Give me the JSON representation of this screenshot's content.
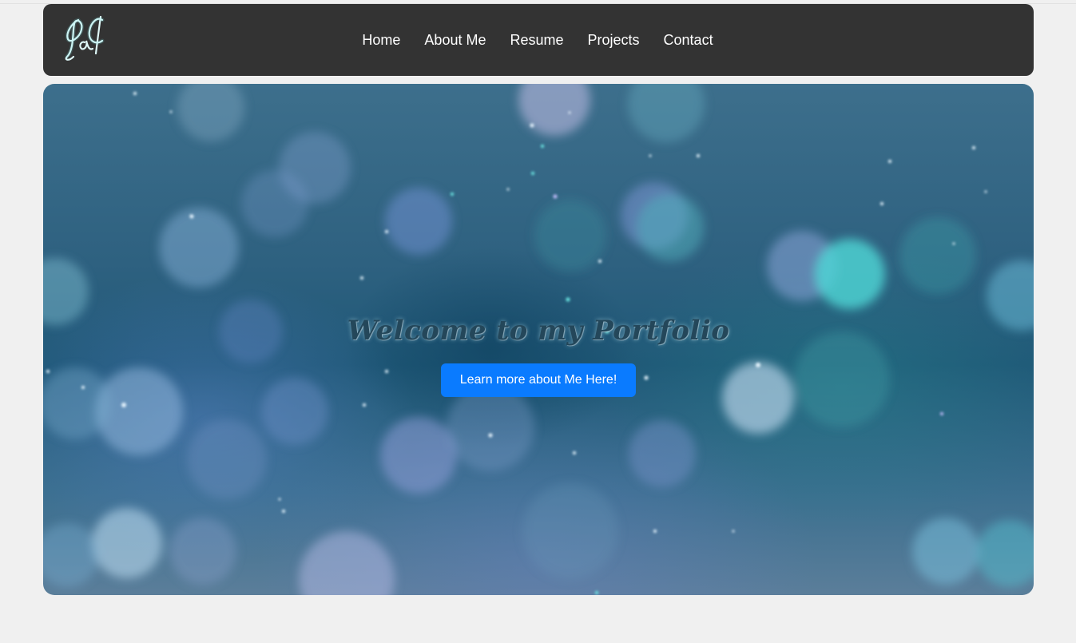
{
  "nav": {
    "logo_text": "LA",
    "links": [
      "Home",
      "About Me",
      "Resume",
      "Projects",
      "Contact"
    ]
  },
  "hero": {
    "title": "Welcome to my Portfolio",
    "button_label": "Learn more about Me Here!"
  },
  "colors": {
    "navbar_bg": "#333333",
    "page_bg": "#f0f0f0",
    "button_bg": "#0a7bff",
    "title_color": "#24475a"
  }
}
